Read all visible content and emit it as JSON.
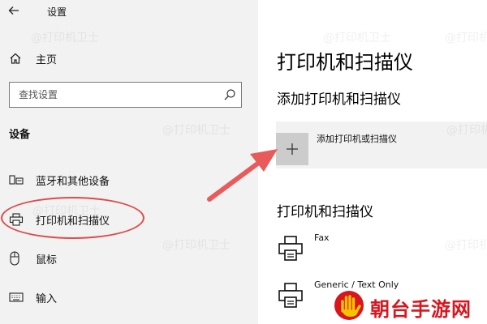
{
  "window": {
    "title": "设置",
    "back_icon": "back-arrow-icon"
  },
  "nav": {
    "home_label": "主页",
    "search_placeholder": "查找设置",
    "section_heading": "设备",
    "items": [
      {
        "label": "蓝牙和其他设备",
        "icon": "bluetooth-devices-icon"
      },
      {
        "label": "打印机和扫描仪",
        "icon": "printer-icon",
        "selected": true
      },
      {
        "label": "鼠标",
        "icon": "mouse-icon"
      },
      {
        "label": "输入",
        "icon": "keyboard-icon"
      }
    ]
  },
  "content": {
    "page_title": "打印机和扫描仪",
    "add_section_heading": "添加打印机和扫描仪",
    "add_button_label": "添加打印机或扫描仪",
    "list_heading": "打印机和扫描仪",
    "devices": [
      {
        "name": "Fax"
      },
      {
        "name": "Generic / Text Only"
      }
    ]
  },
  "watermark_text": "@打印机卫士",
  "logo_text": "朝台手游网",
  "colors": {
    "nav_background": "#f2f2f2",
    "annotation_red": "#e04a4a",
    "logo_red": "#d9151d",
    "add_tile_gray": "#cccccc"
  }
}
